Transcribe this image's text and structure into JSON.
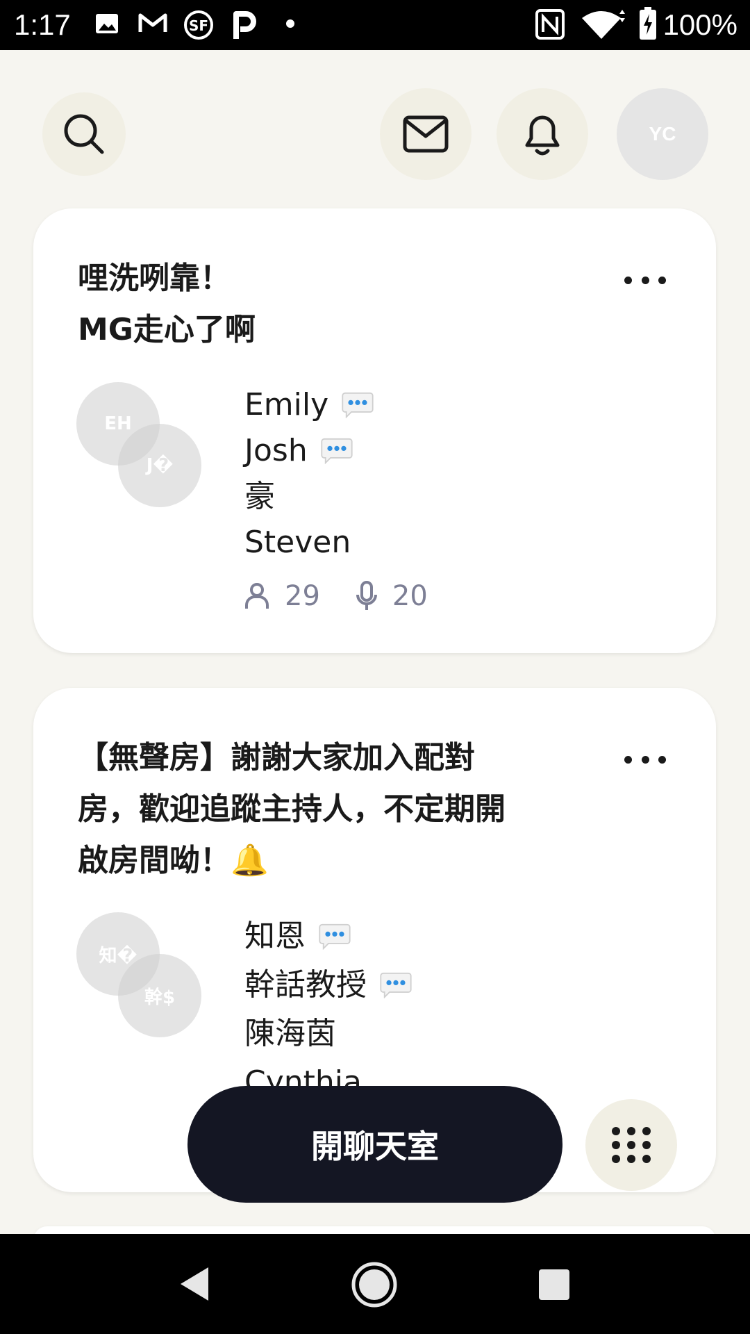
{
  "status_bar": {
    "time": "1:17",
    "battery": "100%",
    "icons": [
      "image-icon",
      "gmail-icon",
      "sf-app-icon",
      "p-app-icon",
      "dot-icon",
      "nfc-icon",
      "wifi-icon",
      "battery-icon"
    ]
  },
  "header": {
    "search_icon": "search-icon",
    "mail_icon": "mail-icon",
    "bell_icon": "bell-icon",
    "profile_initials": "YC"
  },
  "rooms": [
    {
      "title_lines": [
        "哩洗咧靠！",
        "MG走心了啊"
      ],
      "avatars": [
        "EH",
        "J�"
      ],
      "speakers": [
        {
          "name": "Emily",
          "speaking": true
        },
        {
          "name": "Josh",
          "speaking": true
        },
        {
          "name": "豪",
          "speaking": false
        },
        {
          "name": "Steven",
          "speaking": false
        }
      ],
      "listeners": "29",
      "speaker_count": "20"
    },
    {
      "title_lines": [
        "【無聲房】謝謝大家加入配對",
        "房，歡迎追蹤主持人，不定期開",
        "啟房間呦！🔔"
      ],
      "avatars": [
        "知�",
        "幹$"
      ],
      "speakers": [
        {
          "name": "知恩",
          "speaking": true
        },
        {
          "name": "幹話教授",
          "speaking": true
        },
        {
          "name": "陳海茵",
          "speaking": false
        },
        {
          "name": "Cynthia",
          "speaking": false
        }
      ]
    }
  ],
  "start_room_button": "開聊天室",
  "colors": {
    "background": "#f6f5f0",
    "icon_button_bg": "#f1efe4",
    "primary_button": "#141623",
    "stat_gray": "#7d7f95",
    "speaking_dots": "#2f8fe0"
  }
}
